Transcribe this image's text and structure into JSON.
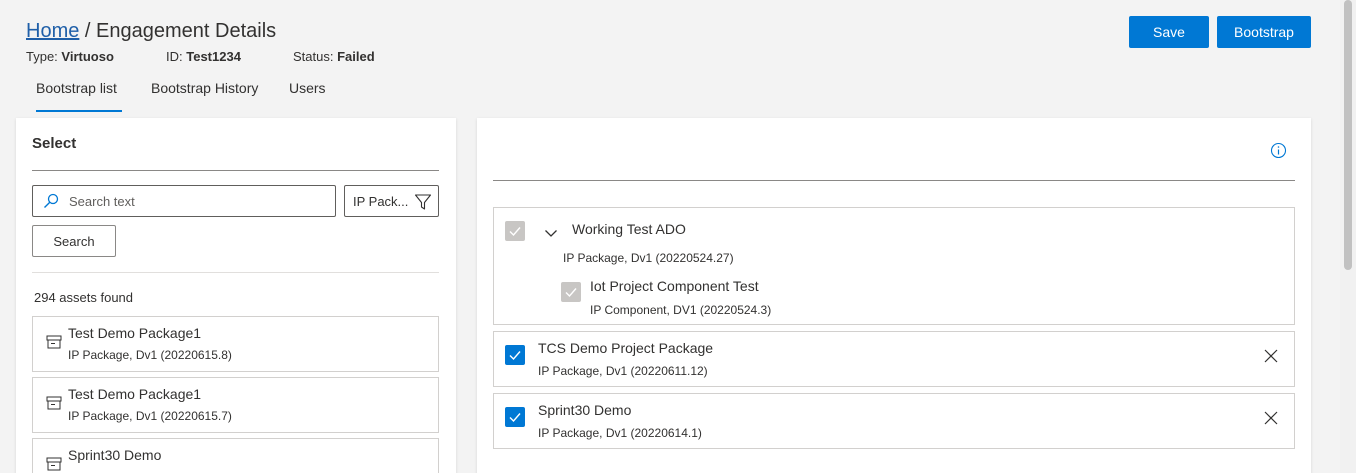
{
  "breadcrumb": {
    "home": "Home",
    "separator": " / ",
    "current": "Engagement Details"
  },
  "meta": {
    "type_label": "Type: ",
    "type_value": "Virtuoso",
    "id_label": "ID: ",
    "id_value": "Test1234",
    "status_label": "Status: ",
    "status_value": "Failed"
  },
  "tabs": [
    {
      "label": "Bootstrap list",
      "active": true
    },
    {
      "label": "Bootstrap History",
      "active": false
    },
    {
      "label": "Users",
      "active": false
    }
  ],
  "actions": {
    "save": "Save",
    "bootstrap": "Bootstrap"
  },
  "left": {
    "title": "Select",
    "search_placeholder": "Search text",
    "search_value": "",
    "filter_value": "IP Pack...",
    "search_button": "Search",
    "count_text": "294 assets found",
    "items": [
      {
        "title": "Test Demo Package1",
        "subtitle": "IP Package, Dv1 (20220615.8)"
      },
      {
        "title": "Test Demo Package1",
        "subtitle": "IP Package, Dv1 (20220615.7)"
      },
      {
        "title": "Sprint30 Demo",
        "subtitle": ""
      }
    ]
  },
  "right": {
    "selected": [
      {
        "title": "Working Test ADO",
        "subtitle": "IP Package, Dv1 (20220524.27)",
        "checked": true,
        "disabled": true,
        "expanded": true,
        "children": [
          {
            "title": "Iot Project Component Test",
            "subtitle": "IP Component, DV1 (20220524.3)",
            "checked": true,
            "disabled": true
          }
        ]
      },
      {
        "title": "TCS Demo Project Package",
        "subtitle": "IP Package, Dv1 (20220611.12)",
        "checked": true,
        "disabled": false
      },
      {
        "title": "Sprint30 Demo",
        "subtitle": "IP Package, Dv1 (20220614.1)",
        "checked": true,
        "disabled": false
      }
    ]
  },
  "colors": {
    "accent": "#0078d4",
    "link": "#1f5fa8",
    "disabled_check": "#c8c6c4"
  },
  "icons": [
    "search-icon",
    "filter-icon",
    "package-icon",
    "info-icon",
    "chevron-down-icon",
    "checkmark-icon",
    "close-icon"
  ]
}
